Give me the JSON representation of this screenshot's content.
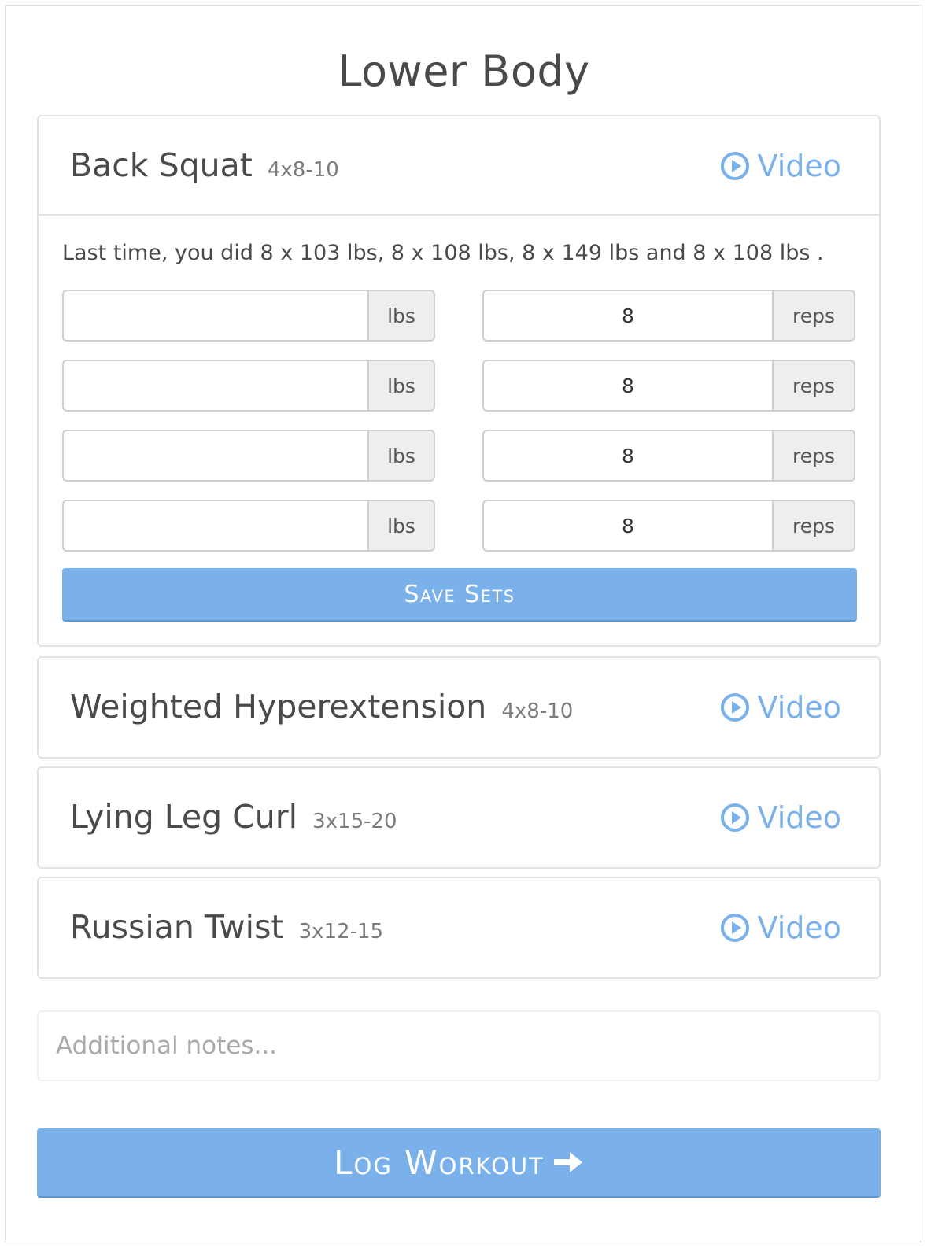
{
  "page": {
    "title": "Lower Body"
  },
  "colors": {
    "accent": "#7ab1ea",
    "text": "#4a4a4a",
    "muted": "#7c7c7c",
    "border": "#e3e3e3",
    "addon_bg": "#eeeeee"
  },
  "exercises": [
    {
      "name": "Back Squat",
      "scheme": "4x8-10",
      "video_label": "Video",
      "video_icon": "play-circle-icon",
      "expanded": true,
      "last_time": "Last time, you did 8 x 103 lbs, 8 x 108 lbs, 8 x 149 lbs and 8 x 108 lbs .",
      "sets": [
        {
          "weight": "",
          "weight_unit": "lbs",
          "reps": "8",
          "reps_unit": "reps"
        },
        {
          "weight": "",
          "weight_unit": "lbs",
          "reps": "8",
          "reps_unit": "reps"
        },
        {
          "weight": "",
          "weight_unit": "lbs",
          "reps": "8",
          "reps_unit": "reps"
        },
        {
          "weight": "",
          "weight_unit": "lbs",
          "reps": "8",
          "reps_unit": "reps"
        }
      ],
      "save_label": "Save Sets"
    },
    {
      "name": "Weighted Hyperextension",
      "scheme": "4x8-10",
      "video_label": "Video",
      "video_icon": "play-circle-icon",
      "expanded": false
    },
    {
      "name": "Lying Leg Curl",
      "scheme": "3x15-20",
      "video_label": "Video",
      "video_icon": "play-circle-icon",
      "expanded": false
    },
    {
      "name": "Russian Twist",
      "scheme": "3x12-15",
      "video_label": "Video",
      "video_icon": "play-circle-icon",
      "expanded": false
    }
  ],
  "notes": {
    "value": "",
    "placeholder": "Additional notes..."
  },
  "log_button": {
    "label": "Log Workout",
    "icon": "arrow-right-icon"
  }
}
